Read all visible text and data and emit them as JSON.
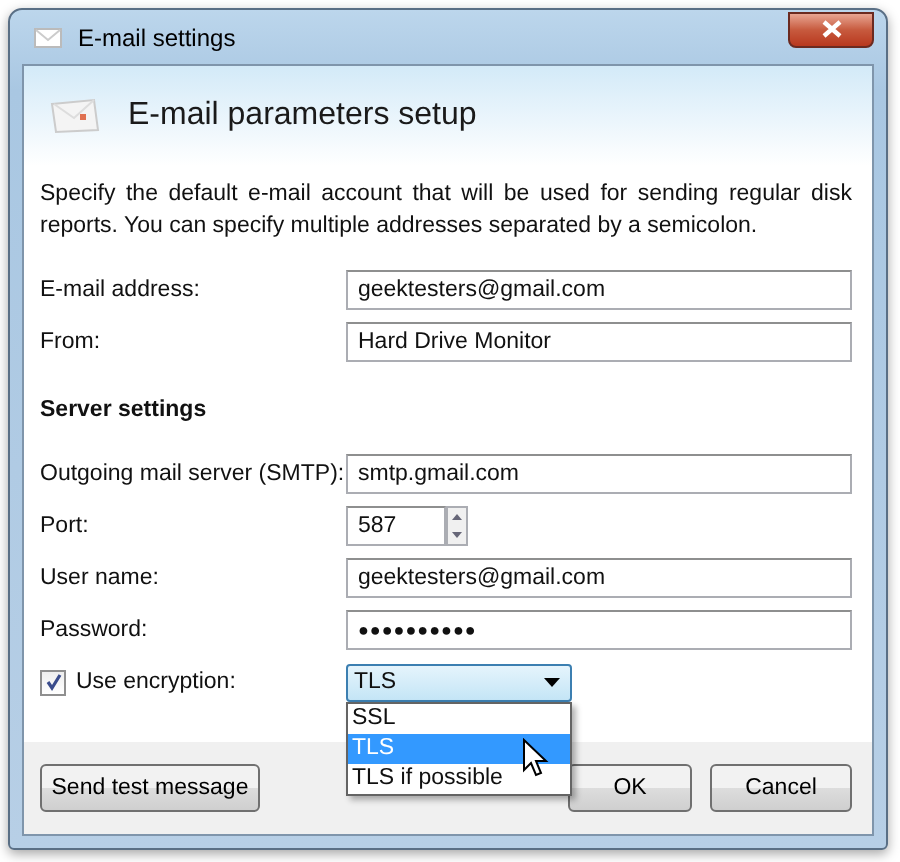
{
  "window": {
    "title": "E-mail settings"
  },
  "header": {
    "title": "E-mail parameters setup"
  },
  "description": "Specify the default e-mail account that will be used for sending regular disk reports. You can specify multiple addresses separated by a semicolon.",
  "account_fields": [
    {
      "label": "E-mail address:",
      "value": "geektesters@gmail.com",
      "kind": "text"
    },
    {
      "label": "From:",
      "value": "Hard Drive Monitor",
      "kind": "text"
    }
  ],
  "server_section": {
    "heading": "Server settings",
    "fields": [
      {
        "label": "Outgoing mail server (SMTP):",
        "value": "smtp.gmail.com",
        "kind": "text"
      },
      {
        "label": "Port:",
        "value": "587",
        "kind": "spinner"
      },
      {
        "label": "User name:",
        "value": "geektesters@gmail.com",
        "kind": "text"
      },
      {
        "label": "Password:",
        "value": "●●●●●●●●●●",
        "kind": "password"
      }
    ]
  },
  "encryption": {
    "label": "Use encryption:",
    "checked": true,
    "value": "TLS",
    "expanded": true,
    "options": [
      {
        "label": "SSL",
        "selected": false
      },
      {
        "label": "TLS",
        "selected": true
      },
      {
        "label": "TLS if possible",
        "selected": false
      }
    ]
  },
  "buttons": [
    {
      "label": "Send test message"
    },
    {
      "label": "OK"
    },
    {
      "label": "Cancel"
    }
  ]
}
